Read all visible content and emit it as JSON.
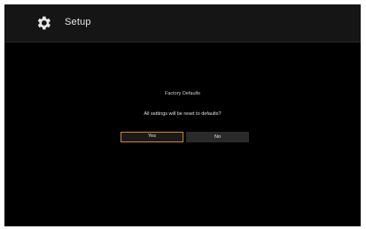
{
  "header": {
    "title": "Setup",
    "icon": "gear-icon"
  },
  "dialog": {
    "title": "Factory Defaults",
    "message": "All settings will be reset to defaults?",
    "buttons": {
      "yes": "Yes",
      "no": "No"
    },
    "focused_button": "yes"
  },
  "colors": {
    "background": "#000000",
    "header_bg": "#151515",
    "focus_border": "#d08a2a",
    "text": "#e6e6e6"
  }
}
